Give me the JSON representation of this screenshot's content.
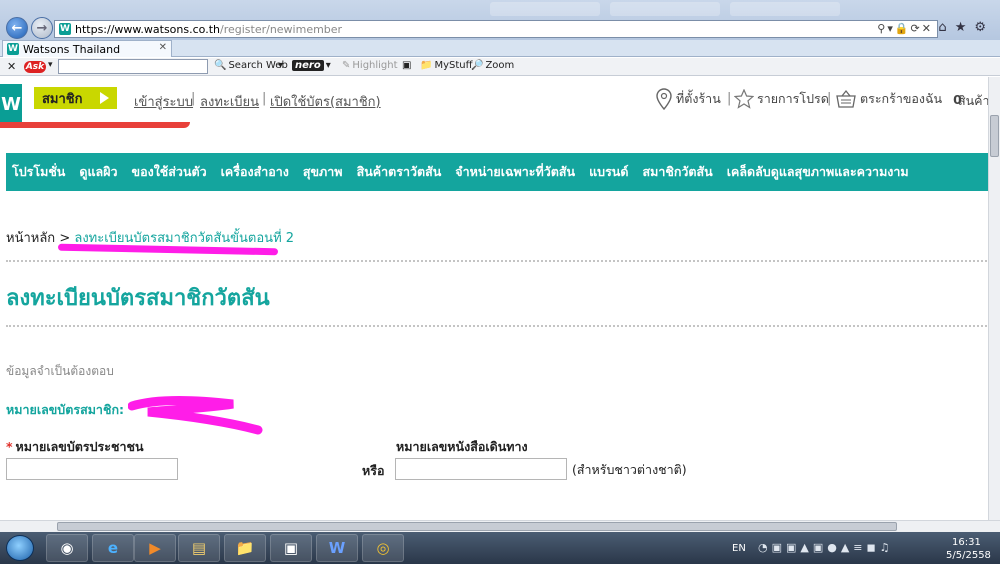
{
  "browser": {
    "url_domain": "https://www.watsons.co.th",
    "url_path": "/register/newimember",
    "tab_title": "Watsons Thailand",
    "toolbar": {
      "search_web": "Search Web",
      "nero": "nero",
      "highlight": "Highlight",
      "mystuff": "MyStuff",
      "zoom": "Zoom"
    }
  },
  "header": {
    "logo_letter": "W",
    "member_badge": "สมาชิก",
    "links": [
      "เข้าสู่ระบบ",
      "ลงทะเบียน",
      "เปิดใช้บัตร(สมาชิก)"
    ],
    "store_locator": "ที่ตั้งร้าน",
    "wishlist": "รายการโปรด",
    "cart": "ตระกร้าของฉัน",
    "cart_count": "0",
    "products": "สินค้า"
  },
  "nav": {
    "items": [
      "โปรโมชั่น",
      "ดูแลผิว",
      "ของใช้ส่วนตัว",
      "เครื่องสำอาง",
      "สุขภาพ",
      "สินค้าตราวัตสัน",
      "จำหน่ายเฉพาะที่วัตสัน",
      "แบรนด์",
      "สมาชิกวัตสัน",
      "เคล็ดลับดูแลสุขภาพและความงาม"
    ]
  },
  "breadcrumb": {
    "home": "หน้าหลัก",
    "separator": ">",
    "current": "ลงทะเบียนบัตรสมาชิกวัตสันขั้นตอนที่ 2"
  },
  "form": {
    "title": "ลงทะเบียนบัตรสมาชิกวัตสัน",
    "required_note": "ข้อมูลจำเป็นต้องตอบ",
    "card_number_label": "หมายเลขบัตรสมาชิก:",
    "required_star": "*",
    "id_card_label": "หมายเลขบัตรประชาชน",
    "or_label": "หรือ",
    "passport_label": "หมายเลขหนังสือเดินทาง",
    "foreign_note": "(สำหรับชาวต่างชาติ)",
    "id_card_value": "",
    "passport_value": ""
  },
  "taskbar": {
    "language": "EN",
    "time": "16:31",
    "date": "5/5/2558"
  },
  "colors": {
    "brand_teal": "#14a59e",
    "member_badge": "#c9d700",
    "redaction": "#ff1de8"
  }
}
